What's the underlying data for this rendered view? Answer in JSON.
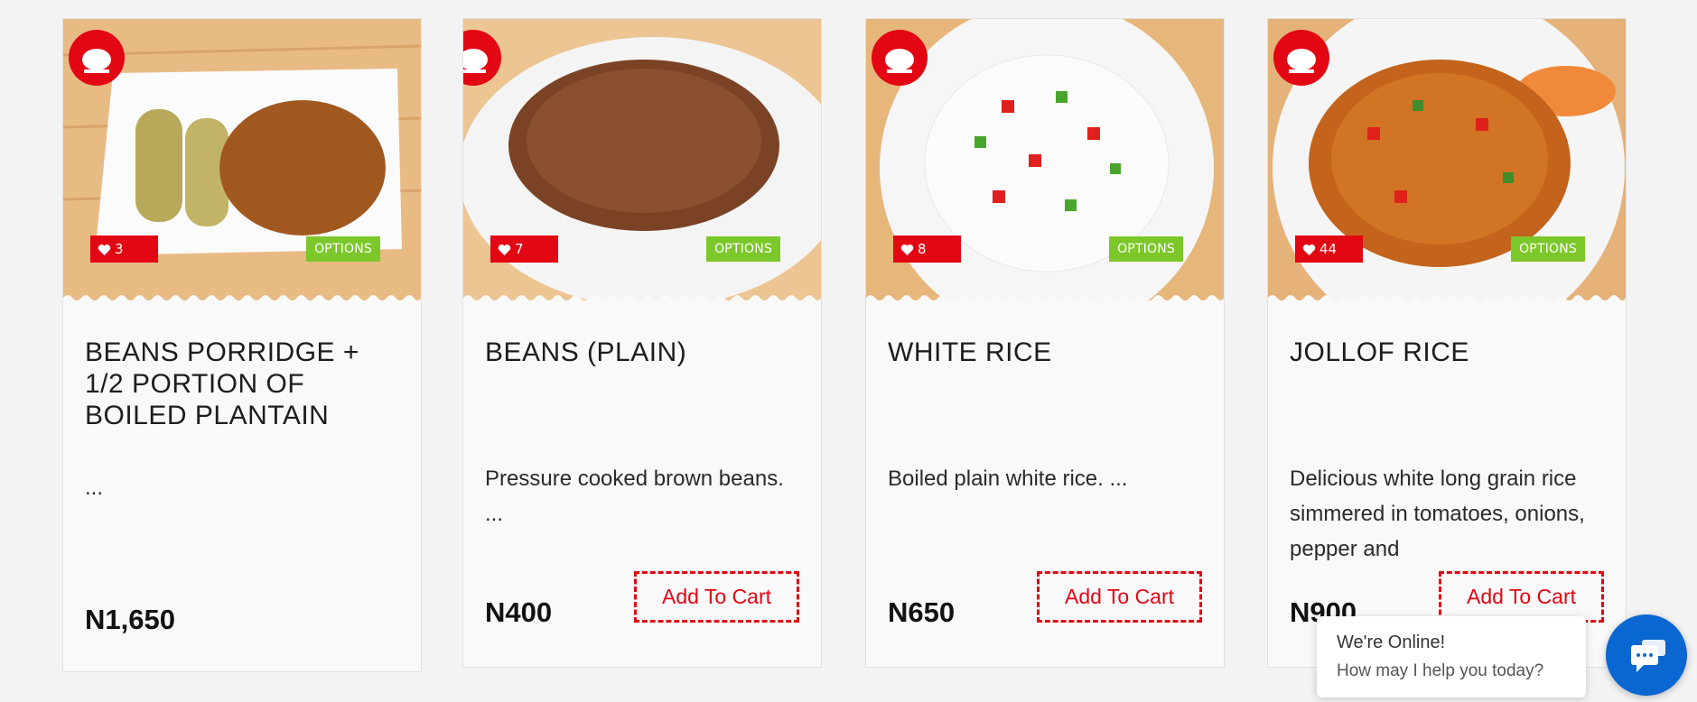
{
  "brand": {
    "accent": "#e30613",
    "options_color": "#7cc72a",
    "chat_color": "#0a66d0"
  },
  "products": [
    {
      "title": "BEANS PORRIDGE + 1/2 PORTION OF BOILED PLANTAIN",
      "description": "...",
      "price": "N1,650",
      "likes": "3",
      "options_label": "OPTIONS",
      "cart_label": "",
      "image": "beans-porridge-plantain"
    },
    {
      "title": "BEANS (PLAIN)",
      "description": "Pressure cooked brown beans. ...",
      "price": "N400",
      "likes": "7",
      "options_label": "OPTIONS",
      "cart_label": "Add To Cart",
      "image": "plain-beans"
    },
    {
      "title": "WHITE RICE",
      "description": "Boiled plain white rice. ...",
      "price": "N650",
      "likes": "8",
      "options_label": "OPTIONS",
      "cart_label": "Add To Cart",
      "image": "white-rice"
    },
    {
      "title": "JOLLOF RICE",
      "description": "Delicious white long grain rice simmered in tomatoes, onions, pepper and",
      "price": "N900",
      "likes": "44",
      "options_label": "OPTIONS",
      "cart_label": "Add To Cart",
      "image": "jollof-rice"
    }
  ],
  "chat": {
    "line1": "We're Online!",
    "line2": "How may I help you today?",
    "icon": "chat-icon"
  }
}
